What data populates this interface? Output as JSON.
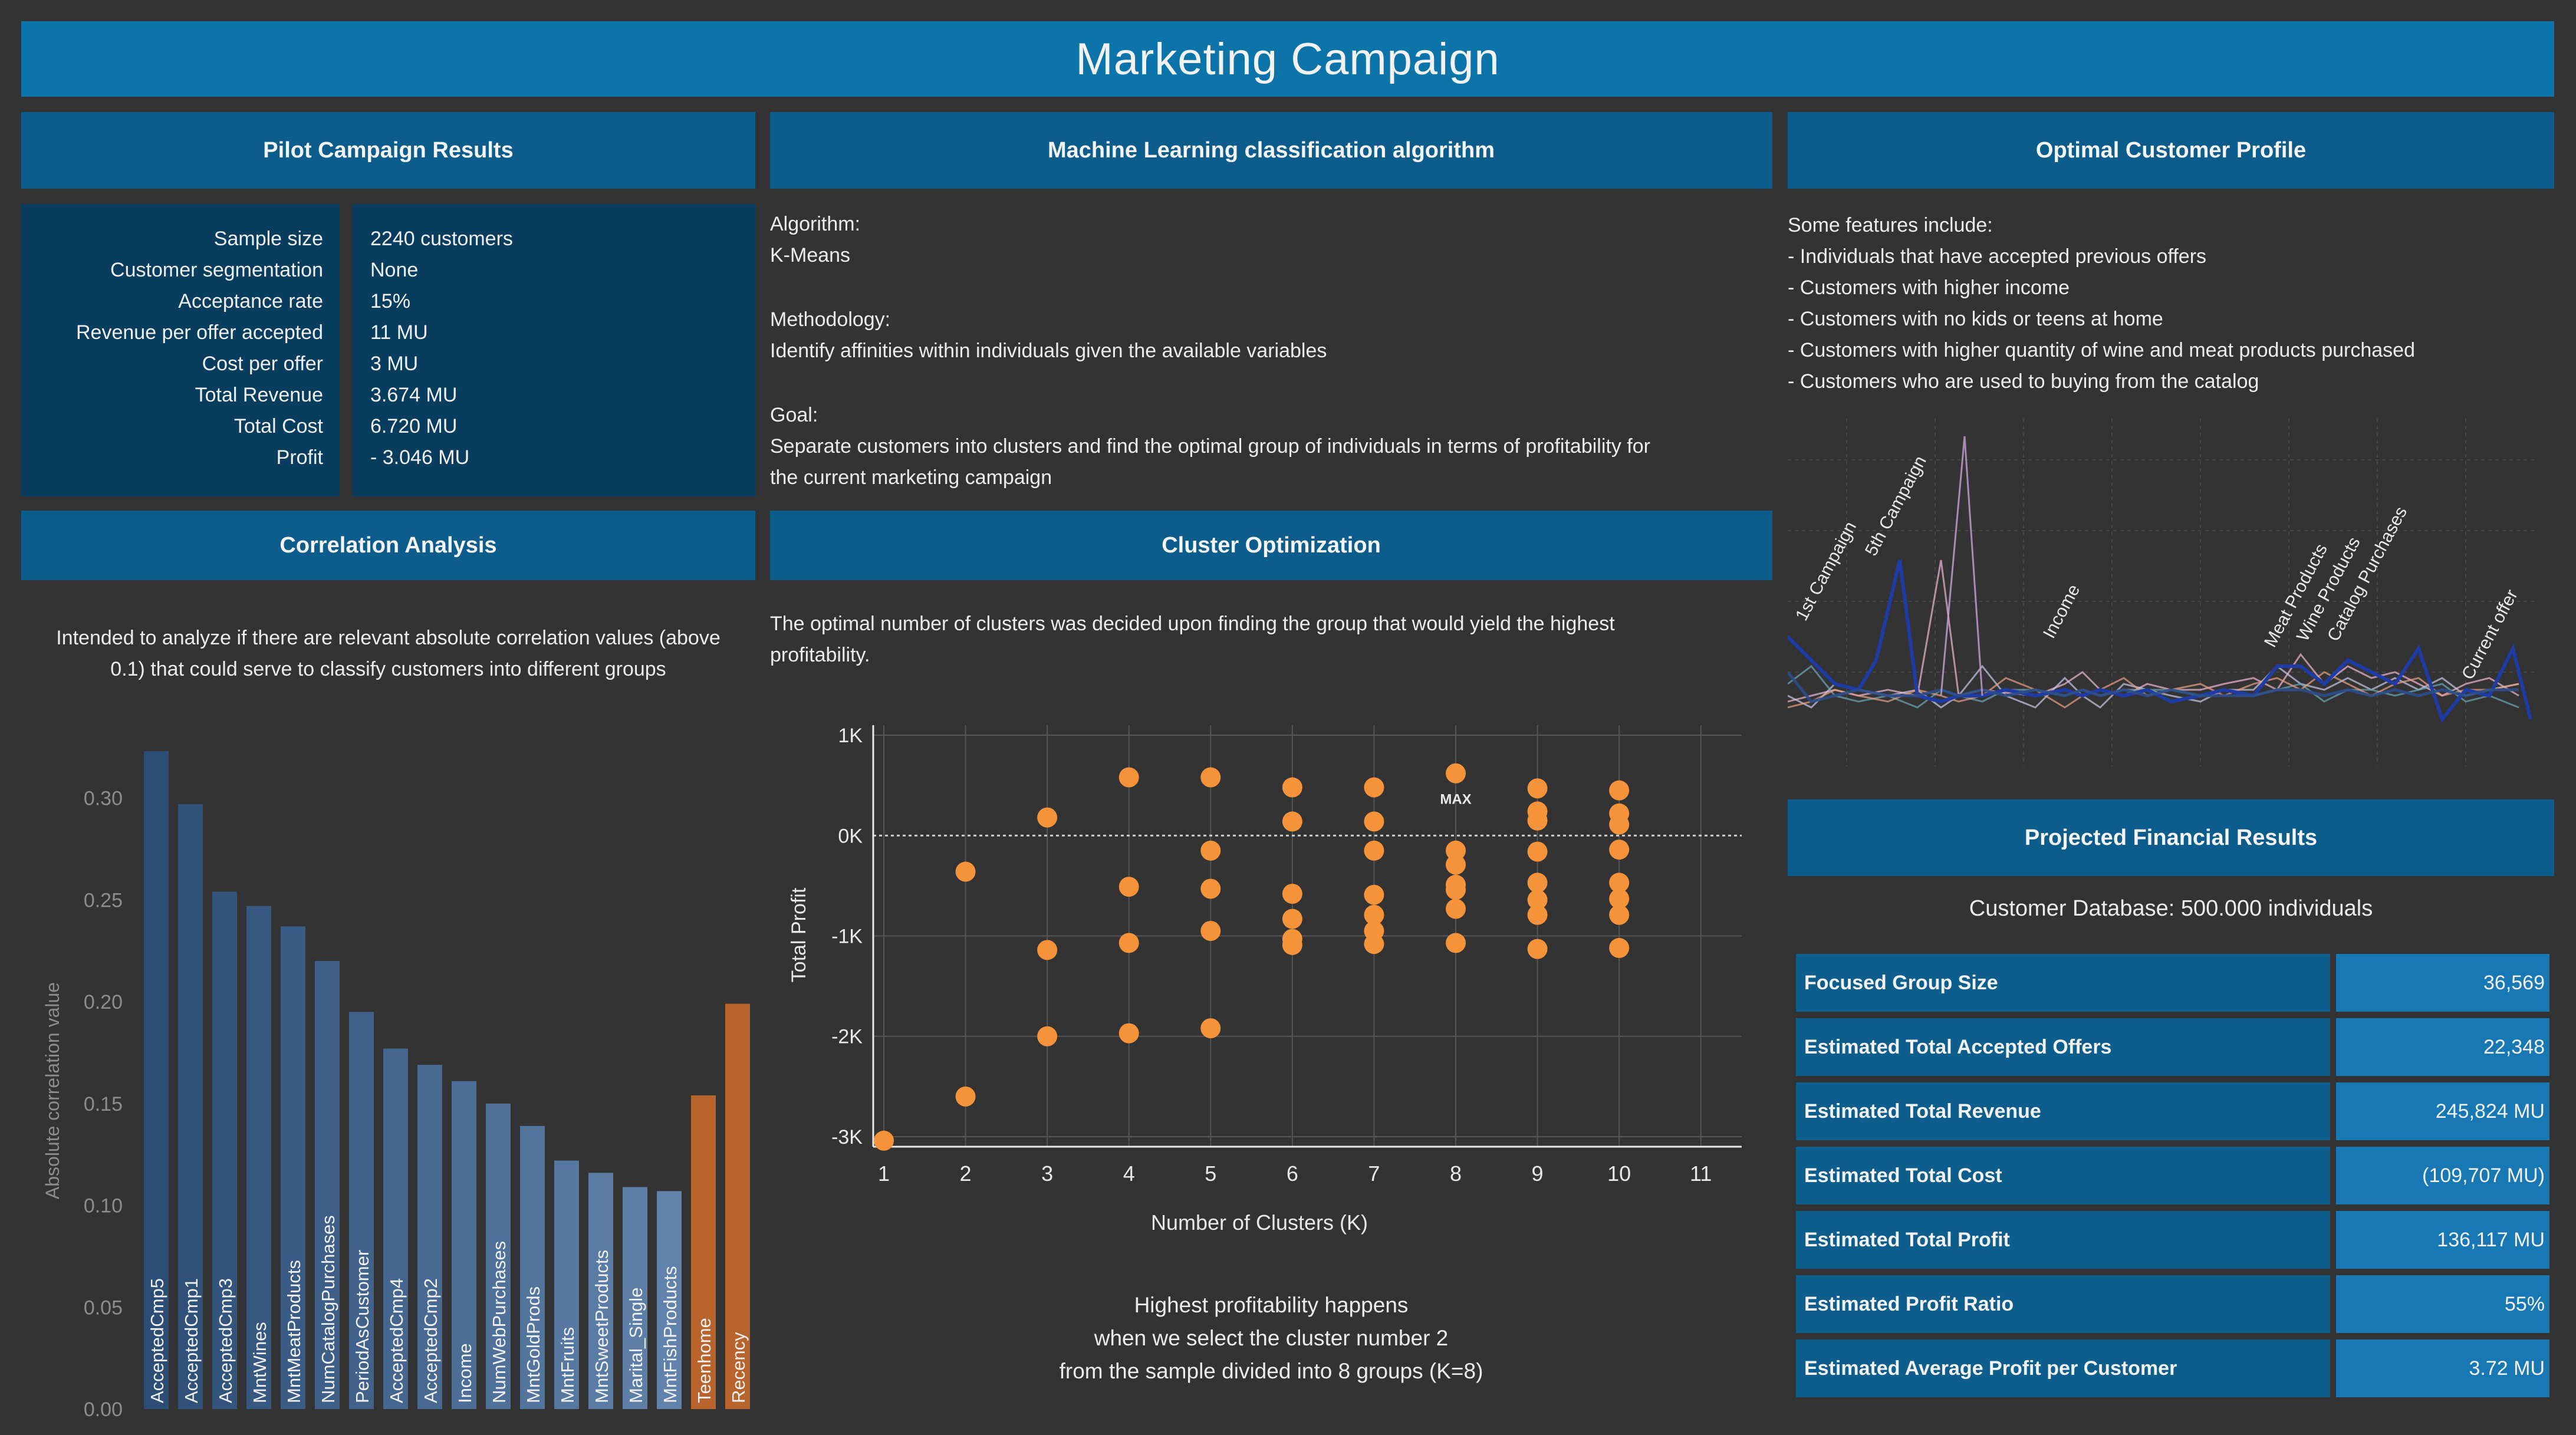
{
  "title": "Marketing Campaign",
  "panels": {
    "pilot": "Pilot Campaign Results",
    "ml": "Machine Learning classification algorithm",
    "profile": "Optimal Customer Profile",
    "correlation": "Correlation Analysis",
    "cluster": "Cluster Optimization",
    "financial": "Projected Financial Results"
  },
  "pilot_results": [
    {
      "label": "Sample size",
      "value": "2240 customers"
    },
    {
      "label": "Customer segmentation",
      "value": "None"
    },
    {
      "label": "Acceptance rate",
      "value": "15%"
    },
    {
      "label": "Revenue per offer accepted",
      "value": "11 MU"
    },
    {
      "label": "Cost per offer",
      "value": "3 MU"
    },
    {
      "label": "Total Revenue",
      "value": "3.674 MU"
    },
    {
      "label": "Total Cost",
      "value": "6.720 MU"
    },
    {
      "label": "Profit",
      "value": "- 3.046 MU"
    }
  ],
  "ml_text": {
    "algorithm_label": "Algorithm:",
    "algorithm": "K-Means",
    "methodology_label": "Methodology:",
    "methodology": "Identify affinities within individuals given the available variables",
    "goal_label": "Goal:",
    "goal_line1": "Separate customers into clusters and find the optimal group of individuals in terms of profitability for",
    "goal_line2": "the current marketing campaign"
  },
  "profile": {
    "intro": "Some features include:",
    "features": [
      "- Individuals that have accepted previous offers",
      "- Customers with higher income",
      "- Customers with no kids or teens at home",
      "- Customers with higher quantity of wine and meat products purchased",
      "- Customers who are used to buying from the catalog"
    ],
    "chart_labels": [
      "1st Campaign",
      "5th Campaign",
      "Income",
      "Meat Products",
      "Wine Products",
      "Catalog Purchases",
      "Current offer"
    ]
  },
  "correlation_text": {
    "line1": "Intended to analyze if there are relevant absolute correlation values (above",
    "line2": "0.1) that could serve to classify customers into different groups"
  },
  "cluster_text": {
    "line1": "The optimal number of clusters was decided upon finding the group that would yield the highest",
    "line2": "profitability.",
    "note1": "Highest profitability happens",
    "note2": "when we select the cluster number 2",
    "note3": "from the sample divided into 8 groups (K=8)"
  },
  "financial": {
    "database": "Customer Database: 500.000 individuals",
    "rows": [
      {
        "label": "Focused Group Size",
        "value": "36,569"
      },
      {
        "label": "Estimated Total Accepted Offers",
        "value": "22,348"
      },
      {
        "label": "Estimated Total Revenue",
        "value": "245,824 MU"
      },
      {
        "label": "Estimated Total Cost",
        "value": "(109,707 MU)"
      },
      {
        "label": "Estimated Total Profit",
        "value": "136,117 MU"
      },
      {
        "label": "Estimated Profit Ratio",
        "value": "55%"
      },
      {
        "label": "Estimated Average Profit per Customer",
        "value": "3.72 MU"
      }
    ]
  },
  "colors": {
    "background": "#333333",
    "header": "#0c5d8c",
    "title": "#0c74a8",
    "bar_blue": "#4a6f94",
    "bar_orange": "#b8642c",
    "dot": "#f5933a"
  },
  "chart_data": [
    {
      "type": "bar",
      "ylabel": "Absolute correlation value",
      "ylim": [
        0,
        0.33
      ],
      "yticks": [
        "0.00",
        "0.05",
        "0.10",
        "0.15",
        "0.20",
        "0.25",
        "0.30"
      ],
      "categories": [
        "AcceptedCmp5",
        "AcceptedCmp1",
        "AcceptedCmp3",
        "MntWines",
        "MntMeatProducts",
        "NumCatalogPurchases",
        "PeriodAsCustomer",
        "AcceptedCmp4",
        "AcceptedCmp2",
        "Income",
        "NumWebPurchases",
        "MntGoldProds",
        "MntFruits",
        "MntSweetProducts",
        "Marital_Single",
        "MntFishProducts",
        "Teenhome",
        "Recency"
      ],
      "values": [
        0.323,
        0.297,
        0.254,
        0.247,
        0.237,
        0.22,
        0.195,
        0.177,
        0.169,
        0.161,
        0.15,
        0.139,
        0.122,
        0.116,
        0.109,
        0.107,
        0.154,
        0.199
      ],
      "highlight": [
        "Teenhome",
        "Recency"
      ],
      "grid": false
    },
    {
      "type": "scatter",
      "xlabel": "Number of Clusters (K)",
      "ylabel": "Total Profit",
      "xlim": [
        1,
        11
      ],
      "ylim": [
        -3100,
        1100
      ],
      "xticks": [
        "1",
        "2",
        "3",
        "4",
        "5",
        "6",
        "7",
        "8",
        "9",
        "10",
        "11"
      ],
      "yticks": [
        "1K",
        "0K",
        "-1K",
        "-2K",
        "-3K"
      ],
      "reference_line": 0,
      "annotation": "MAX",
      "grid": true,
      "points": [
        {
          "x": 1,
          "y": -3040
        },
        {
          "x": 2,
          "y": -360
        },
        {
          "x": 2,
          "y": -2600
        },
        {
          "x": 3,
          "y": 180
        },
        {
          "x": 3,
          "y": -1140
        },
        {
          "x": 3,
          "y": -2000
        },
        {
          "x": 4,
          "y": 580
        },
        {
          "x": 4,
          "y": -510
        },
        {
          "x": 4,
          "y": -1070
        },
        {
          "x": 4,
          "y": -1970
        },
        {
          "x": 5,
          "y": 580
        },
        {
          "x": 5,
          "y": -150
        },
        {
          "x": 5,
          "y": -530
        },
        {
          "x": 5,
          "y": -950
        },
        {
          "x": 5,
          "y": -1920
        },
        {
          "x": 6,
          "y": 480
        },
        {
          "x": 6,
          "y": 140
        },
        {
          "x": 6,
          "y": -580
        },
        {
          "x": 6,
          "y": -830
        },
        {
          "x": 6,
          "y": -1030
        },
        {
          "x": 6,
          "y": -1090
        },
        {
          "x": 7,
          "y": 480
        },
        {
          "x": 7,
          "y": 140
        },
        {
          "x": 7,
          "y": -150
        },
        {
          "x": 7,
          "y": -590
        },
        {
          "x": 7,
          "y": -790
        },
        {
          "x": 7,
          "y": -950
        },
        {
          "x": 7,
          "y": -1080
        },
        {
          "x": 8,
          "y": 620
        },
        {
          "x": 8,
          "y": -150
        },
        {
          "x": 8,
          "y": -290
        },
        {
          "x": 8,
          "y": -490
        },
        {
          "x": 8,
          "y": -540
        },
        {
          "x": 8,
          "y": -730
        },
        {
          "x": 8,
          "y": -1070
        },
        {
          "x": 9,
          "y": 470
        },
        {
          "x": 9,
          "y": 240
        },
        {
          "x": 9,
          "y": 150
        },
        {
          "x": 9,
          "y": -160
        },
        {
          "x": 9,
          "y": -470
        },
        {
          "x": 9,
          "y": -640
        },
        {
          "x": 9,
          "y": -790
        },
        {
          "x": 9,
          "y": -1130
        },
        {
          "x": 10,
          "y": 450
        },
        {
          "x": 10,
          "y": 220
        },
        {
          "x": 10,
          "y": 110
        },
        {
          "x": 10,
          "y": -140
        },
        {
          "x": 10,
          "y": -470
        },
        {
          "x": 10,
          "y": -630
        },
        {
          "x": 10,
          "y": -790
        },
        {
          "x": 10,
          "y": -1120
        }
      ]
    }
  ]
}
